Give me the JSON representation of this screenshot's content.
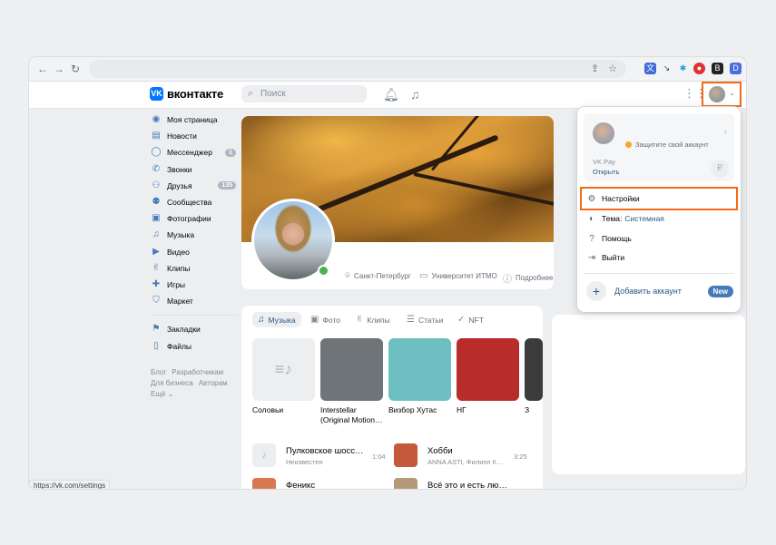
{
  "header": {
    "logo_text": "вконтакте",
    "logo_mark": "VK",
    "search_placeholder": "Поиск"
  },
  "sidebar": {
    "items": [
      {
        "label": "Моя страница",
        "icon": "profile-icon"
      },
      {
        "label": "Новости",
        "icon": "news-icon"
      },
      {
        "label": "Мессенджер",
        "icon": "messenger-icon",
        "badge": "1"
      },
      {
        "label": "Звонки",
        "icon": "phone-icon"
      },
      {
        "label": "Друзья",
        "icon": "friends-icon",
        "badge": "135"
      },
      {
        "label": "Сообщества",
        "icon": "communities-icon"
      },
      {
        "label": "Фотографии",
        "icon": "photos-icon"
      },
      {
        "label": "Музыка",
        "icon": "music-icon"
      },
      {
        "label": "Видео",
        "icon": "video-icon"
      },
      {
        "label": "Клипы",
        "icon": "clips-icon"
      },
      {
        "label": "Игры",
        "icon": "games-icon"
      },
      {
        "label": "Маркет",
        "icon": "market-icon"
      }
    ],
    "secondary": [
      {
        "label": "Закладки",
        "icon": "bookmark-icon"
      },
      {
        "label": "Файлы",
        "icon": "files-icon"
      }
    ],
    "footer_links": [
      "Блог",
      "Разработчикам",
      "Для бизнеса",
      "Авторам",
      "Ещё ⌄"
    ]
  },
  "profile": {
    "city": "Санкт-Петербург",
    "university": "Университет ИТМО",
    "more": "Подробнее"
  },
  "media": {
    "tabs": [
      "Музыка",
      "Фото",
      "Клипы",
      "Статьи",
      "NFT"
    ],
    "albums": [
      {
        "title": "Соловьи",
        "color": "#edeef0"
      },
      {
        "title": "Interstellar (Original Motion…",
        "color": "#6f7478"
      },
      {
        "title": "Визбор Хутас",
        "color": "#6dbfc1"
      },
      {
        "title": "НГ",
        "color": "#b82c2a"
      },
      {
        "title": "З",
        "color": "#3b3b3b"
      }
    ],
    "tracks": [
      {
        "title": "Пулковское шосс…",
        "artist": "Неизвестен",
        "duration": "1:04",
        "color": "#edeef0"
      },
      {
        "title": "Хобби",
        "artist": "ANNA ASTI, Филипп К…",
        "duration": "3:25",
        "color": "#c55a3a"
      },
      {
        "title": "Феникс",
        "artist": "",
        "duration": "",
        "color": "#d9784e"
      },
      {
        "title": "Всё это и есть лю…",
        "artist": "",
        "duration": "",
        "color": "#b59a7a"
      }
    ]
  },
  "dropdown": {
    "warning": "Защитите свой аккаунт",
    "vkpay_label": "VK Pay",
    "vkpay_action": "Открыть",
    "settings": "Настройки",
    "theme_label": "Тема:",
    "theme_value": "Системная",
    "help": "Помощь",
    "logout": "Выйти",
    "add_account": "Добавить аккаунт",
    "new_badge": "New"
  },
  "status_url": "https://vk.com/settings",
  "colors": {
    "accent": "#0077ff",
    "link": "#2a5885",
    "highlight": "#f26a1a",
    "online": "#4bb34b"
  }
}
